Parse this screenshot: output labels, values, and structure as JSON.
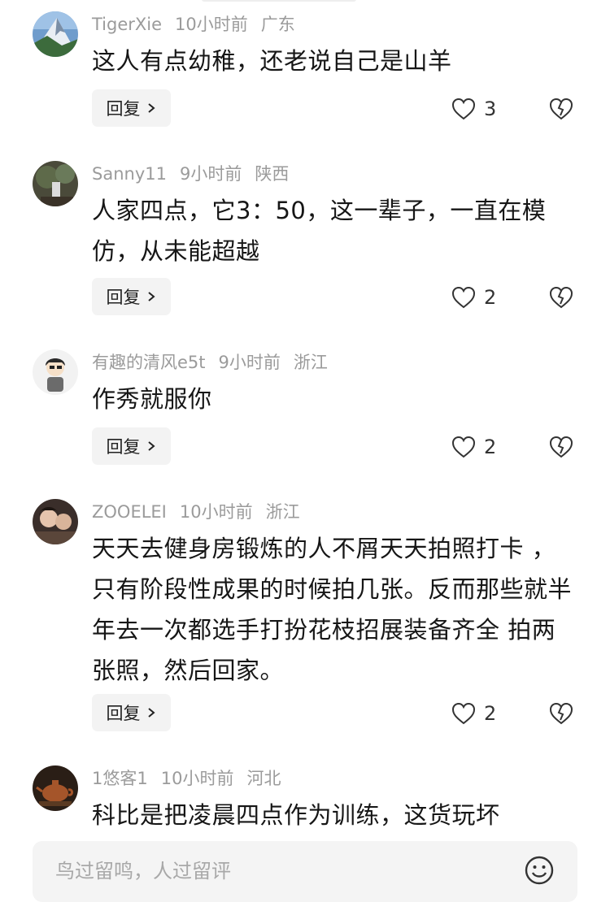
{
  "comments": [
    {
      "username": "TigerXie",
      "time": "10小时前",
      "location": "广东",
      "text": "这人有点幼稚，还老说自己是山羊",
      "reply_label": "回复",
      "likes": "3",
      "avatar": "mountain-avatar"
    },
    {
      "username": "Sanny11",
      "time": "9小时前",
      "location": "陕西",
      "text": "人家四点，它3：50，这一辈子，一直在模仿，从未能超越",
      "reply_label": "回复",
      "likes": "2",
      "avatar": "outdoor-avatar"
    },
    {
      "username": "有趣的清风e5t",
      "time": "9小时前",
      "location": "浙江",
      "text": "作秀就服你",
      "reply_label": "回复",
      "likes": "2",
      "avatar": "cartoon-avatar"
    },
    {
      "username": "ZOOELEI",
      "time": "10小时前",
      "location": "浙江",
      "text": "天天去健身房锻炼的人不屑天天拍照打卡 ，只有阶段性成果的时候拍几张。反而那些就半年去一次都选手打扮花枝招展装备齐全 拍两张照，然后回家。",
      "reply_label": "回复",
      "likes": "2",
      "avatar": "selfie-avatar"
    },
    {
      "username": "1悠客1",
      "time": "10小时前",
      "location": "河北",
      "text": "科比是把凌晨四点作为训练，这货玩坏",
      "avatar": "teapot-avatar"
    }
  ],
  "composer": {
    "placeholder": "鸟过留鸣，人过留评"
  }
}
